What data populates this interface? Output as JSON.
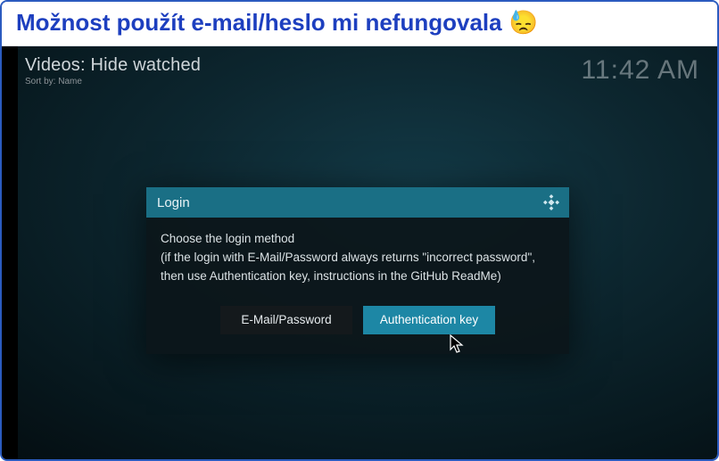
{
  "caption": {
    "text": "Možnost použít e-mail/heslo mi nefungovala",
    "emoji": "😓"
  },
  "topbar": {
    "breadcrumb": "Videos: Hide watched",
    "sort": "Sort by: Name",
    "clock": "11:42 AM"
  },
  "dialog": {
    "title": "Login",
    "body_line1": "Choose the login method",
    "body_line2": "(if the login with E-Mail/Password always returns \"incorrect password\", then use Authentication key, instructions in the GitHub ReadMe)",
    "btn_email": "E-Mail/Password",
    "btn_auth": "Authentication key"
  }
}
